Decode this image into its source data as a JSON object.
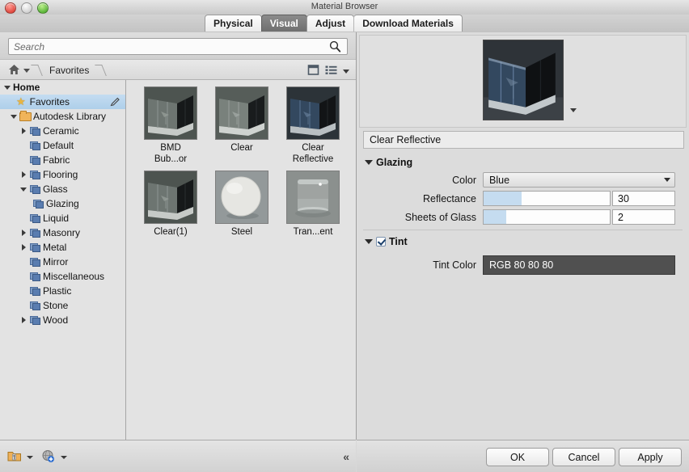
{
  "window": {
    "title": "Material Browser",
    "controls": [
      "close",
      "minimize",
      "zoom"
    ]
  },
  "tabs": [
    {
      "label": "Physical",
      "active": false
    },
    {
      "label": "Visual",
      "active": true
    },
    {
      "label": "Adjust",
      "active": false
    },
    {
      "label": "Download Materials",
      "active": false
    }
  ],
  "search": {
    "value": "",
    "placeholder": "Search",
    "icon": "search-icon"
  },
  "breadcrumb": {
    "home_icon": "home-icon",
    "path": [
      "Favorites"
    ],
    "view_icons": [
      "panel-toggle-icon",
      "list-view-icon",
      "chevron-down-icon"
    ]
  },
  "tree": [
    {
      "label": "Home",
      "depth": 0,
      "twist": "open",
      "icon": "none",
      "selected": false,
      "bold": true
    },
    {
      "label": "Favorites",
      "depth": 1,
      "twist": "none",
      "icon": "star",
      "selected": true,
      "bold": false,
      "edit_icon": "pencil-icon"
    },
    {
      "label": "Autodesk Library",
      "depth": 1,
      "twist": "open",
      "icon": "orange-folder",
      "selected": false,
      "bold": false
    },
    {
      "label": "Ceramic",
      "depth": 2,
      "twist": "closed",
      "icon": "blue-folder",
      "selected": false,
      "bold": false
    },
    {
      "label": "Default",
      "depth": 2,
      "twist": "none",
      "icon": "blue-folder",
      "selected": false,
      "bold": false
    },
    {
      "label": "Fabric",
      "depth": 2,
      "twist": "none",
      "icon": "blue-folder",
      "selected": false,
      "bold": false
    },
    {
      "label": "Flooring",
      "depth": 2,
      "twist": "closed",
      "icon": "blue-folder",
      "selected": false,
      "bold": false
    },
    {
      "label": "Glass",
      "depth": 2,
      "twist": "open",
      "icon": "blue-folder",
      "selected": false,
      "bold": false
    },
    {
      "label": "Glazing",
      "depth": 3,
      "twist": "none",
      "icon": "blue-folder",
      "selected": false,
      "bold": false
    },
    {
      "label": "Liquid",
      "depth": 2,
      "twist": "none",
      "icon": "blue-folder",
      "selected": false,
      "bold": false
    },
    {
      "label": "Masonry",
      "depth": 2,
      "twist": "closed",
      "icon": "blue-folder",
      "selected": false,
      "bold": false
    },
    {
      "label": "Metal",
      "depth": 2,
      "twist": "closed",
      "icon": "blue-folder",
      "selected": false,
      "bold": false
    },
    {
      "label": "Mirror",
      "depth": 2,
      "twist": "none",
      "icon": "blue-folder",
      "selected": false,
      "bold": false
    },
    {
      "label": "Miscellaneous",
      "depth": 2,
      "twist": "none",
      "icon": "blue-folder",
      "selected": false,
      "bold": false
    },
    {
      "label": "Plastic",
      "depth": 2,
      "twist": "none",
      "icon": "blue-folder",
      "selected": false,
      "bold": false
    },
    {
      "label": "Stone",
      "depth": 2,
      "twist": "none",
      "icon": "blue-folder",
      "selected": false,
      "bold": false
    },
    {
      "label": "Wood",
      "depth": 2,
      "twist": "closed",
      "icon": "blue-folder",
      "selected": false,
      "bold": false
    }
  ],
  "materials": [
    {
      "label": "BMD\nBub...or",
      "kind": "glass-box",
      "tint": "#5c6460"
    },
    {
      "label": "Clear",
      "kind": "glass-box",
      "tint": "#69716c"
    },
    {
      "label": "Clear\nReflective",
      "kind": "glass-box",
      "tint": "#2e4560"
    },
    {
      "label": "Clear(1)",
      "kind": "glass-box",
      "tint": "#5c6460"
    },
    {
      "label": "Steel",
      "kind": "sphere",
      "tint": "#dcdcda"
    },
    {
      "label": "Tran...ent",
      "kind": "tumbler",
      "tint": "#9a9e9c"
    }
  ],
  "bottom_left_toolbar": {
    "icons": [
      "new-library-folder-icon",
      "dropdown-caret-icon",
      "new-material-globe-icon",
      "dropdown-caret-icon"
    ],
    "collapse_icon": "collapse-double-chevron-icon"
  },
  "preview": {
    "caret_icon": "preview-options-caret-icon",
    "render_description": "blue tinted glass box"
  },
  "editor": {
    "material_name": "Clear Reflective",
    "sections": [
      {
        "name": "Glazing",
        "expanded": true,
        "has_checkbox": false,
        "properties": [
          {
            "label": "Color",
            "type": "select",
            "value": "Blue"
          },
          {
            "label": "Reflectance",
            "type": "slider",
            "value": "30",
            "fill_percent": 30
          },
          {
            "label": "Sheets of Glass",
            "type": "slider",
            "value": "2",
            "fill_percent": 18
          }
        ]
      },
      {
        "name": "Tint",
        "expanded": true,
        "has_checkbox": true,
        "checked": true,
        "properties": [
          {
            "label": "Tint Color",
            "type": "swatch",
            "value": "RGB 80 80 80",
            "color": "#505050"
          }
        ]
      }
    ]
  },
  "dialog_buttons": [
    {
      "label": "OK"
    },
    {
      "label": "Cancel"
    },
    {
      "label": "Apply"
    }
  ],
  "colors": {
    "slider_fill": "#c5dcf0",
    "selection": "#aecfea",
    "tint_swatch": "#505050",
    "active_tab_bg": "#7a7a7a"
  }
}
